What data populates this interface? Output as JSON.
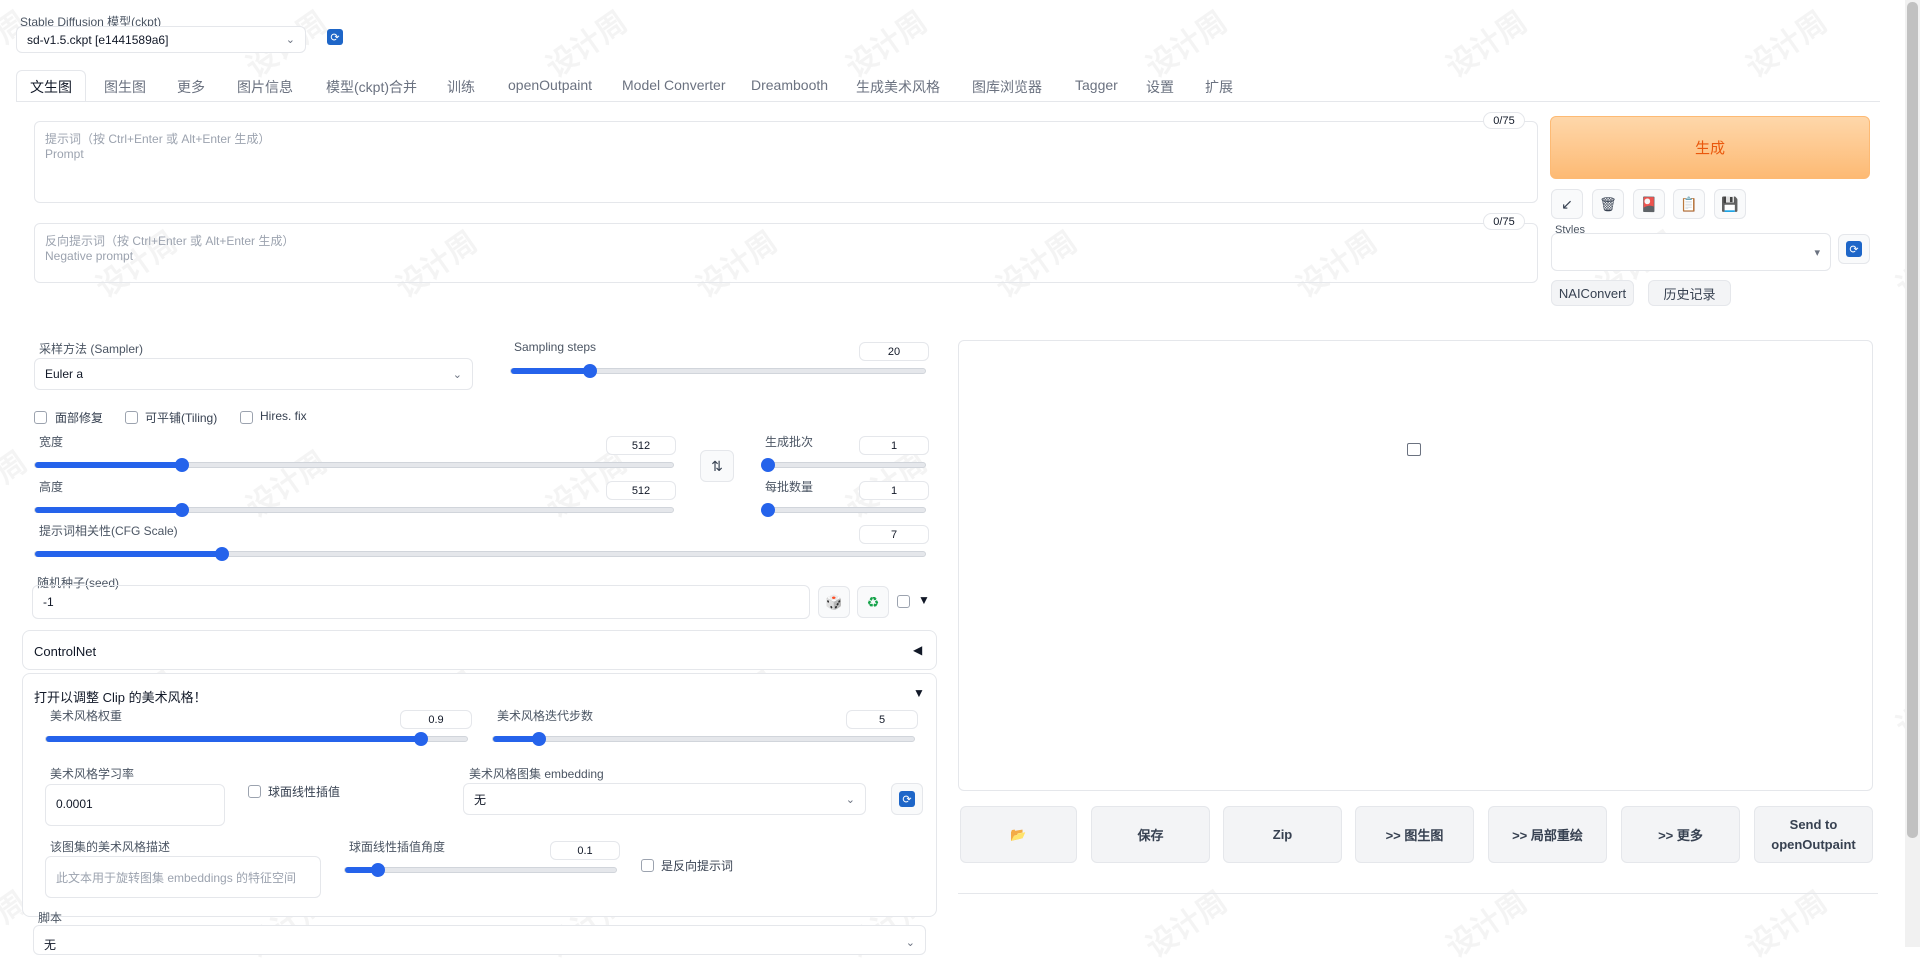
{
  "model": {
    "label": "Stable Diffusion 模型(ckpt)",
    "value": "sd-v1.5.ckpt [e1441589a6]"
  },
  "tabs": [
    "文生图",
    "图生图",
    "更多",
    "图片信息",
    "模型(ckpt)合并",
    "训练",
    "openOutpaint",
    "Model Converter",
    "Dreambooth",
    "生成美术风格",
    "图库浏览器",
    "Tagger",
    "设置",
    "扩展"
  ],
  "prompt": {
    "counter": "0/75",
    "placeholder_line1": "提示词（按 Ctrl+Enter 或 Alt+Enter 生成）",
    "placeholder_line2": "Prompt"
  },
  "negative": {
    "counter": "0/75",
    "placeholder_line1": "反向提示词（按 Ctrl+Enter 或 Alt+Enter 生成）",
    "placeholder_line2": "Negative prompt"
  },
  "generate_label": "生成",
  "styles_label": "Styles",
  "naiconvert_label": "NAIConvert",
  "history_label": "历史记录",
  "sampler": {
    "label": "采样方法 (Sampler)",
    "value": "Euler a"
  },
  "steps": {
    "label": "Sampling steps",
    "value": "20",
    "fraction": 0.19
  },
  "checkboxes": {
    "face": "面部修复",
    "tiling": "可平铺(Tiling)",
    "hires": "Hires. fix"
  },
  "width": {
    "label": "宽度",
    "value": "512",
    "fraction": 0.23
  },
  "height": {
    "label": "高度",
    "value": "512",
    "fraction": 0.23
  },
  "batch_count": {
    "label": "生成批次",
    "value": "1",
    "fraction": 0.0
  },
  "batch_size": {
    "label": "每批数量",
    "value": "1",
    "fraction": 0.0
  },
  "cfg": {
    "label": "提示词相关性(CFG Scale)",
    "value": "7",
    "fraction": 0.21
  },
  "seed": {
    "label": "随机种子(seed)",
    "value": "-1"
  },
  "controlnet_label": "ControlNet",
  "aesthetic": {
    "title": "打开以调整 Clip 的美术风格！",
    "weight": {
      "label": "美术风格权重",
      "value": "0.9",
      "fraction": 0.89
    },
    "steps": {
      "label": "美术风格迭代步数",
      "value": "5",
      "fraction": 0.11
    },
    "lr": {
      "label": "美术风格学习率",
      "value": "0.0001"
    },
    "slerp": "球面线性插值",
    "embedding": {
      "label": "美术风格图集 embedding",
      "value": "无"
    },
    "desc": {
      "label": "该图集的美术风格描述",
      "placeholder": "此文本用于旋转图集 embeddings 的特征空间"
    },
    "slerp_angle": {
      "label": "球面线性插值角度",
      "value": "0.1",
      "fraction": 0.12
    },
    "negative": "是反向提示词"
  },
  "script": {
    "label": "脚本",
    "value": "无"
  },
  "output_buttons": {
    "save": "保存",
    "zip": "Zip",
    "img2img": ">> 图生图",
    "inpaint": ">> 局部重绘",
    "extras": ">> 更多",
    "outpaint": "Send to openOutpaint"
  },
  "watermark": "设计周",
  "colors": {
    "accent": "#2563eb",
    "generate_bg": "#fdba74",
    "generate_text": "#ea580c"
  }
}
